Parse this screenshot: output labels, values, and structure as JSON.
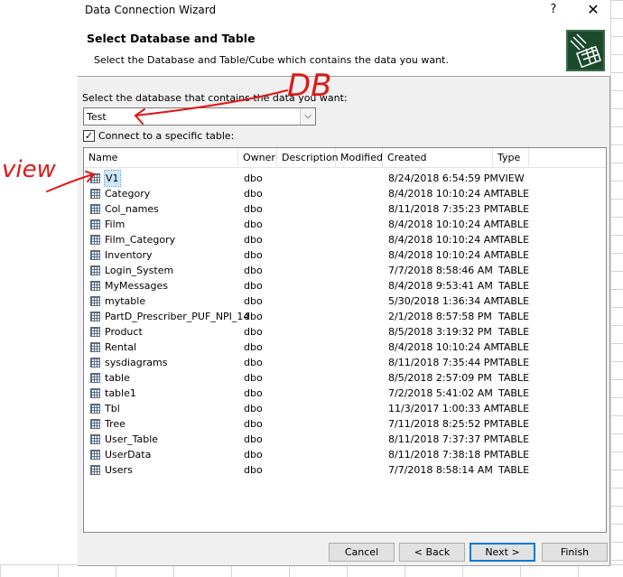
{
  "window": {
    "title": "Data Connection Wizard",
    "help_glyph": "?",
    "close_glyph": "✕"
  },
  "header": {
    "title": "Select Database and Table",
    "subtitle": "Select the Database and Table/Cube which contains the data you want."
  },
  "database": {
    "label": "Select the database that contains the data you want:",
    "selected": "Test"
  },
  "connect_specific": {
    "label": "Connect to a specific table:",
    "checked": true
  },
  "columns": [
    "Name",
    "Owner",
    "Description",
    "Modified",
    "Created",
    "Type"
  ],
  "rows": [
    {
      "name": "V1",
      "owner": "dbo",
      "description": "",
      "modified": "",
      "created": "8/24/2018 6:54:59 PM",
      "type": "VIEW",
      "selected": true
    },
    {
      "name": "Category",
      "owner": "dbo",
      "description": "",
      "modified": "",
      "created": "8/4/2018 10:10:24 AM",
      "type": "TABLE"
    },
    {
      "name": "Col_names",
      "owner": "dbo",
      "description": "",
      "modified": "",
      "created": "8/11/2018 7:35:23 PM",
      "type": "TABLE"
    },
    {
      "name": "Film",
      "owner": "dbo",
      "description": "",
      "modified": "",
      "created": "8/4/2018 10:10:24 AM",
      "type": "TABLE"
    },
    {
      "name": "Film_Category",
      "owner": "dbo",
      "description": "",
      "modified": "",
      "created": "8/4/2018 10:10:24 AM",
      "type": "TABLE"
    },
    {
      "name": "Inventory",
      "owner": "dbo",
      "description": "",
      "modified": "",
      "created": "8/4/2018 10:10:24 AM",
      "type": "TABLE"
    },
    {
      "name": "Login_System",
      "owner": "dbo",
      "description": "",
      "modified": "",
      "created": "7/7/2018 8:58:46 AM",
      "type": "TABLE"
    },
    {
      "name": "MyMessages",
      "owner": "dbo",
      "description": "",
      "modified": "",
      "created": "8/4/2018 9:53:41 AM",
      "type": "TABLE"
    },
    {
      "name": "mytable",
      "owner": "dbo",
      "description": "",
      "modified": "",
      "created": "5/30/2018 1:36:34 AM",
      "type": "TABLE"
    },
    {
      "name": "PartD_Prescriber_PUF_NPI_14",
      "owner": "dbo",
      "description": "",
      "modified": "",
      "created": "2/1/2018 8:57:58 PM",
      "type": "TABLE"
    },
    {
      "name": "Product",
      "owner": "dbo",
      "description": "",
      "modified": "",
      "created": "8/5/2018 3:19:32 PM",
      "type": "TABLE"
    },
    {
      "name": "Rental",
      "owner": "dbo",
      "description": "",
      "modified": "",
      "created": "8/4/2018 10:10:24 AM",
      "type": "TABLE"
    },
    {
      "name": "sysdiagrams",
      "owner": "dbo",
      "description": "",
      "modified": "",
      "created": "8/11/2018 7:35:44 PM",
      "type": "TABLE"
    },
    {
      "name": "table",
      "owner": "dbo",
      "description": "",
      "modified": "",
      "created": "8/5/2018 2:57:09 PM",
      "type": "TABLE"
    },
    {
      "name": "table1",
      "owner": "dbo",
      "description": "",
      "modified": "",
      "created": "7/2/2018 5:41:02 AM",
      "type": "TABLE"
    },
    {
      "name": "Tbl",
      "owner": "dbo",
      "description": "",
      "modified": "",
      "created": "11/3/2017 1:00:33 AM",
      "type": "TABLE"
    },
    {
      "name": "Tree",
      "owner": "dbo",
      "description": "",
      "modified": "",
      "created": "7/11/2018 8:25:52 PM",
      "type": "TABLE"
    },
    {
      "name": "User_Table",
      "owner": "dbo",
      "description": "",
      "modified": "",
      "created": "8/11/2018 7:37:37 PM",
      "type": "TABLE"
    },
    {
      "name": "UserData",
      "owner": "dbo",
      "description": "",
      "modified": "",
      "created": "8/11/2018 7:38:18 PM",
      "type": "TABLE"
    },
    {
      "name": "Users",
      "owner": "dbo",
      "description": "",
      "modified": "",
      "created": "7/7/2018 8:58:14 AM",
      "type": "TABLE"
    }
  ],
  "buttons": {
    "cancel": "Cancel",
    "back": "< Back",
    "next": "Next >",
    "finish": "Finish"
  },
  "annotations": {
    "db": "DB",
    "view": "view",
    "color": "#e01818"
  },
  "icons": {
    "header": "database-plug-icon",
    "table": "table-icon",
    "dropdown": "chevron-down-icon",
    "check": "check-icon"
  }
}
